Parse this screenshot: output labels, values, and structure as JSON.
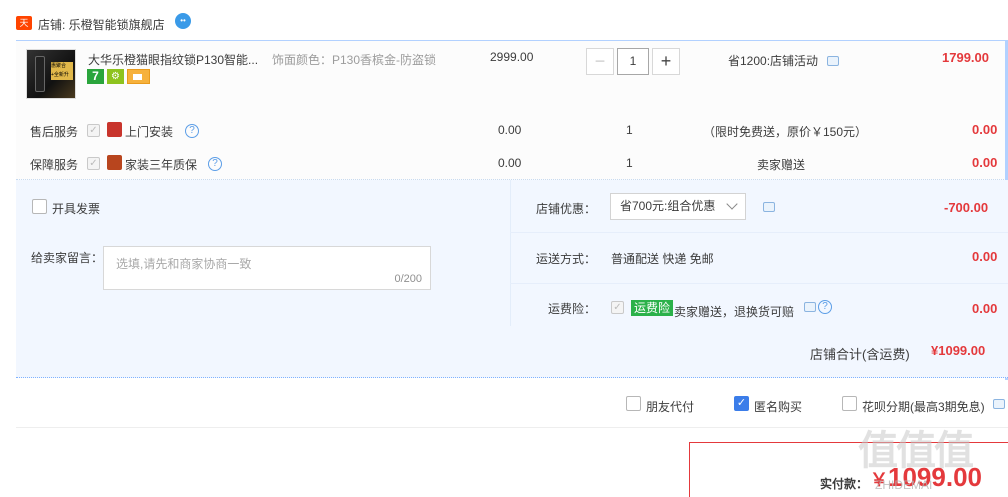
{
  "shop": {
    "badge": "天猫",
    "title": "店铺: 乐橙智能锁旗舰店"
  },
  "item": {
    "thumb_ad": "惠聚合+全新升级",
    "name": "大华乐橙猫眼指纹锁P130智能...",
    "sku": "饰面颜色：P130香槟金-防盗锁",
    "price": "2999.00",
    "quantity": "1",
    "promo": "省1200:店铺活动",
    "subtotal": "1799.00",
    "tags": [
      "7",
      "svc",
      "card"
    ]
  },
  "services": [
    {
      "group_label": "售后服务",
      "name": "上门安装",
      "price": "0.00",
      "qty": "1",
      "note": "（限时免费送，原价￥150元）",
      "amount": "0.00"
    },
    {
      "group_label": "保障服务",
      "name": "家装三年质保",
      "price": "0.00",
      "qty": "1",
      "note": "卖家赠送",
      "amount": "0.00"
    }
  ],
  "order": {
    "invoice_label": "开具发票",
    "memo_label": "给卖家留言：",
    "memo_placeholder": "选填,请先和商家协商一致",
    "memo_count": "0/200",
    "discount_label": "店铺优惠：",
    "discount_selected": "省700元:组合优惠",
    "discount_amount": "-700.00",
    "shipping_label": "运送方式：",
    "shipping_value": "普通配送 快递 免邮",
    "shipping_amount": "0.00",
    "insurance_label": "运费险：",
    "insurance_badge": "运费险",
    "insurance_value": "卖家赠送，退换货可赔",
    "insurance_amount": "0.00",
    "store_total_label": "店铺合计(含运费)",
    "store_total": "¥1099.00"
  },
  "options": {
    "friend_pay": "朋友代付",
    "anonymous": "匿名购买",
    "anonymous_checked": true,
    "huabei": "花呗分期(最高3期免息)"
  },
  "payment": {
    "label": "实付款：",
    "currency": "￥",
    "amount": "1099.00"
  },
  "watermark": {
    "logo": "值值值",
    "text": "ZHIDEMAI"
  },
  "colors": {
    "accent_red": "#e4393c",
    "blue_border": "#b2d1ff",
    "panel_bg": "#f2f7ff",
    "green_badge": "#2bb14a",
    "checkbox_blue": "#3b7de9"
  }
}
